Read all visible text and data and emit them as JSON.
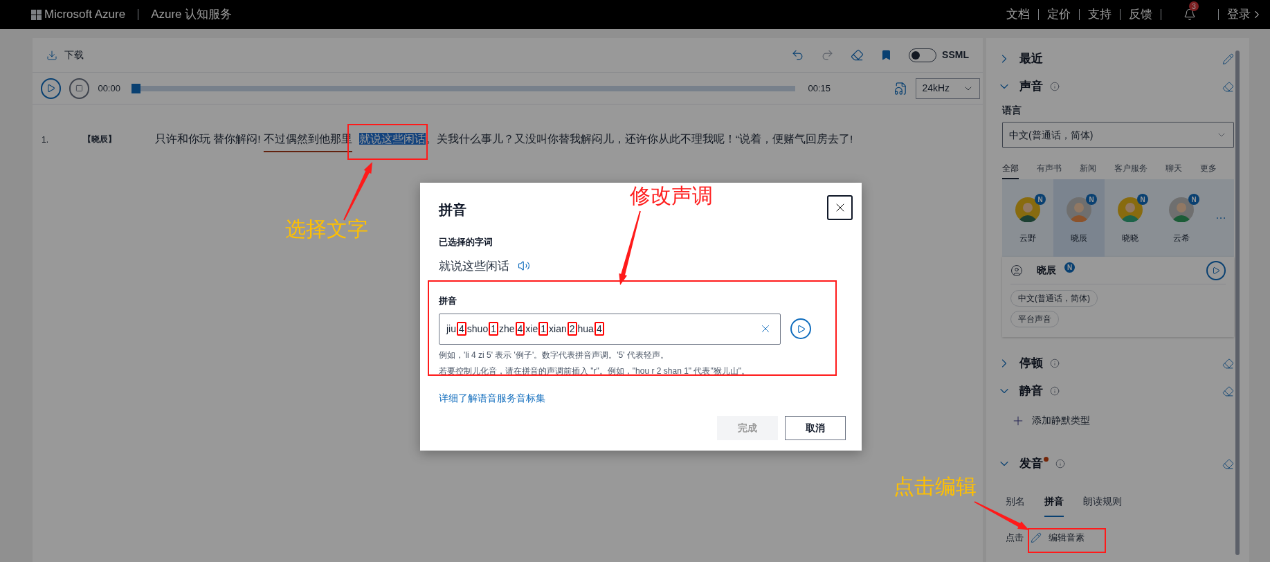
{
  "top_bar": {
    "brand": "Microsoft Azure",
    "product": "Azure 认知服务",
    "links": [
      "文档",
      "定价",
      "支持",
      "反馈"
    ],
    "notifications": "3",
    "sign_in": "登录"
  },
  "toolbar": {
    "download": "下载",
    "ssml": {
      "label": "SSML",
      "on": false
    }
  },
  "player": {
    "elapsed": "00:00",
    "level": 0,
    "duration": "00:15",
    "sample_rate": "24kHz"
  },
  "script": [
    {
      "number": "1.",
      "speaker": "【晓辰】",
      "segments": [
        {
          "kind": "plain",
          "text": "只许和你玩 替你解闷! "
        },
        {
          "kind": "underlined",
          "text": "不过偶然到他那里"
        },
        {
          "kind": "selected",
          "text": "就说这些闲话"
        },
        {
          "kind": "plain",
          "text": "。关我什么事儿？又没叫你替我解闷儿，还许你从此不理我呢！“说着，便赌气回房去了!"
        }
      ]
    }
  ],
  "side_panel": {
    "sections": [
      {
        "kind": "recent",
        "title": "最近",
        "expanded": false
      },
      {
        "kind": "voice",
        "title": "声音",
        "expanded": true,
        "language_label": "语言",
        "language": "中文(普通话，简体)",
        "tabs": [
          {
            "label": "全部",
            "selected": true
          },
          {
            "label": "有声书",
            "selected": false
          },
          {
            "label": "新闻",
            "selected": false
          },
          {
            "label": "客户服务",
            "selected": false
          },
          {
            "label": "聊天",
            "selected": false
          },
          {
            "label": "更多",
            "selected": false
          }
        ],
        "voices": [
          {
            "name": "云野",
            "badge": "N",
            "selected": false
          },
          {
            "name": "晓辰",
            "badge": "N",
            "selected": true
          },
          {
            "name": "晓晓",
            "badge": "N",
            "selected": false
          },
          {
            "name": "云希",
            "badge": "N",
            "selected": false
          }
        ],
        "more": "…",
        "selected_voice": {
          "name": "晓辰",
          "badge": "N",
          "tags": [
            "中文(普通话，简体)",
            "平台声音"
          ]
        }
      },
      {
        "kind": "pause",
        "title": "停顿",
        "expanded": false
      },
      {
        "kind": "silence",
        "title": "静音",
        "expanded": true,
        "add": "添加静默类型"
      },
      {
        "kind": "pronunciation",
        "title": "发音",
        "expanded": true,
        "modified": true,
        "tabs": [
          {
            "label": "别名",
            "selected": false
          },
          {
            "label": "拼音",
            "selected": true
          },
          {
            "label": "朗读规则",
            "selected": false
          }
        ],
        "hint": "点击",
        "edit": "编辑音素"
      }
    ]
  },
  "dialog": {
    "title": "拼音",
    "selected_label": "已选择的字词",
    "selected_text": "就说这些闲话",
    "pinyin_label": "拼音",
    "syllables": [
      {
        "pinyin": "jiu",
        "tone": "4"
      },
      {
        "pinyin": "shuo",
        "tone": "1"
      },
      {
        "pinyin": "zhe",
        "tone": "4"
      },
      {
        "pinyin": "xie",
        "tone": "1"
      },
      {
        "pinyin": "xian",
        "tone": "2"
      },
      {
        "pinyin": "hua",
        "tone": "4"
      }
    ],
    "hints": [
      "例如，'li 4 zi 5' 表示 '例子'。数字代表拼音声调。'5' 代表轻声。",
      "若要控制儿化音，请在拼音的声调前插入 \"r\"。例如，\"hou r 2 shan 1\" 代表\"猴儿山\"。"
    ],
    "link": "详细了解语音服务音标集",
    "buttons": [
      {
        "label": "完成",
        "kind": "primary",
        "disabled": true
      },
      {
        "label": "取消",
        "kind": "secondary",
        "disabled": false
      }
    ]
  },
  "annotations": [
    {
      "kind": "select-text",
      "text": "选择文字"
    },
    {
      "kind": "edit-tone",
      "text": "修改声调"
    },
    {
      "kind": "click-edit",
      "text": "点击编辑"
    }
  ]
}
